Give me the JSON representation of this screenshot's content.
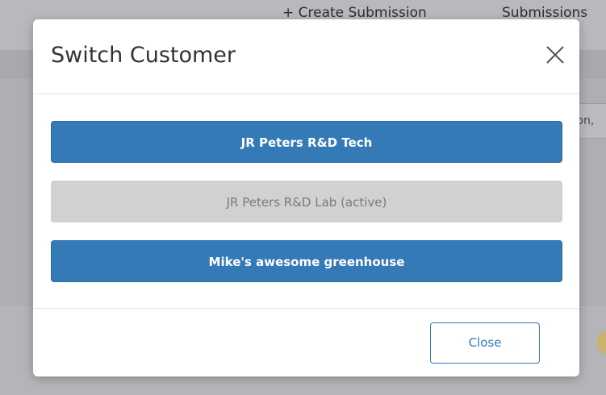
{
  "background": {
    "nav": {
      "create_label": "+ Create Submission",
      "submissions_label": "Submissions"
    },
    "search_partial": "tion,"
  },
  "modal": {
    "title": "Switch Customer",
    "close_icon": "close-x-icon",
    "customers": [
      {
        "label": "JR Peters R&D Tech",
        "state": "selectable"
      },
      {
        "label": "JR Peters R&D Lab (active)",
        "state": "active"
      },
      {
        "label": "Mike's awesome greenhouse",
        "state": "selectable"
      }
    ],
    "footer": {
      "close_label": "Close"
    }
  },
  "colors": {
    "primary": "#337ab7",
    "disabled_bg": "#d1d1d1",
    "disabled_text": "#7a7a7a",
    "overlay": "#a7a9ac"
  }
}
